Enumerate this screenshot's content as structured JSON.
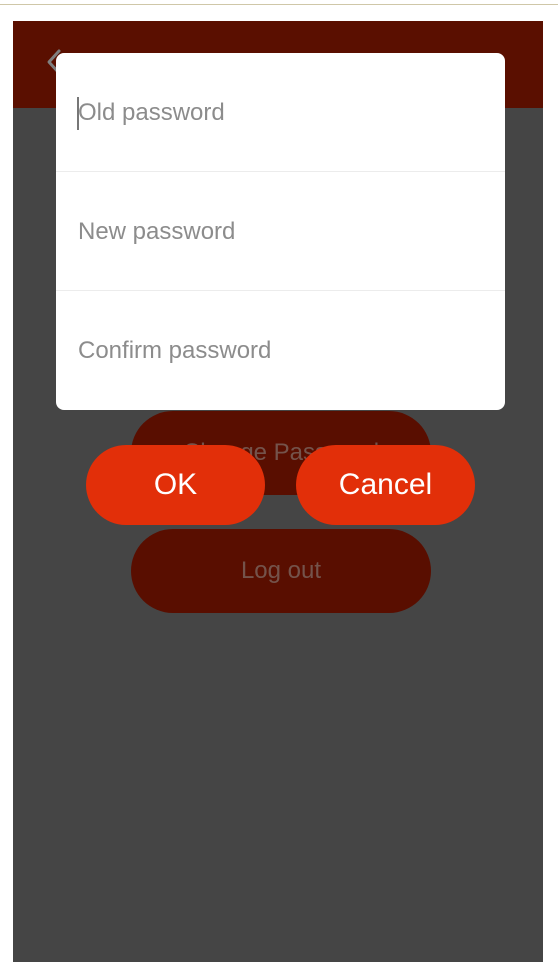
{
  "form": {
    "old_password_placeholder": "Old password",
    "new_password_placeholder": "New password",
    "confirm_password_placeholder": "Confirm password"
  },
  "actions": {
    "ok_label": "OK",
    "cancel_label": "Cancel"
  },
  "page": {
    "change_password_label": "Change Password",
    "logout_label": "Log out"
  },
  "icons": {
    "back": "chevron-left-icon"
  },
  "colors": {
    "app_bar": "#b51f00",
    "page_button": "#b21d00",
    "dialog_button": "#e22f09",
    "screen_background": "#8a8a8a"
  }
}
